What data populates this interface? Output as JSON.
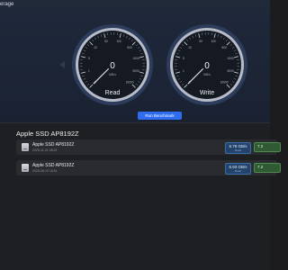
{
  "window": {
    "title": "erage"
  },
  "gauges": {
    "read": {
      "label": "Read",
      "value": "0",
      "unit": "MB/s",
      "ticks": [
        "0",
        "1",
        "5",
        "10",
        "50",
        "100",
        "500",
        "1000",
        "5000",
        "10000"
      ]
    },
    "write": {
      "label": "Write",
      "value": "0",
      "unit": "MB/s",
      "ticks": [
        "0",
        "1",
        "5",
        "10",
        "50",
        "100",
        "500",
        "1000",
        "5000",
        "10000"
      ]
    }
  },
  "run_button_label": "Run Benchmark",
  "drive_heading": "Apple SSD AP8192Z",
  "results": [
    {
      "name": "Apple SSD AP8192Z",
      "date": "2025-11-21 08:29",
      "read_value": "5.78 GB/s",
      "read_label": "Read",
      "write_value": "7.2"
    },
    {
      "name": "Apple SSD AP8192Z",
      "date": "2025-08-10 16:51",
      "read_value": "6.93 GB/s",
      "read_label": "Read",
      "write_value": "7.2"
    }
  ],
  "colors": {
    "accent": "#2f6cf0",
    "read_badge": "#23436a",
    "write_badge": "#2f5a33",
    "needle": "#d9dde6"
  }
}
